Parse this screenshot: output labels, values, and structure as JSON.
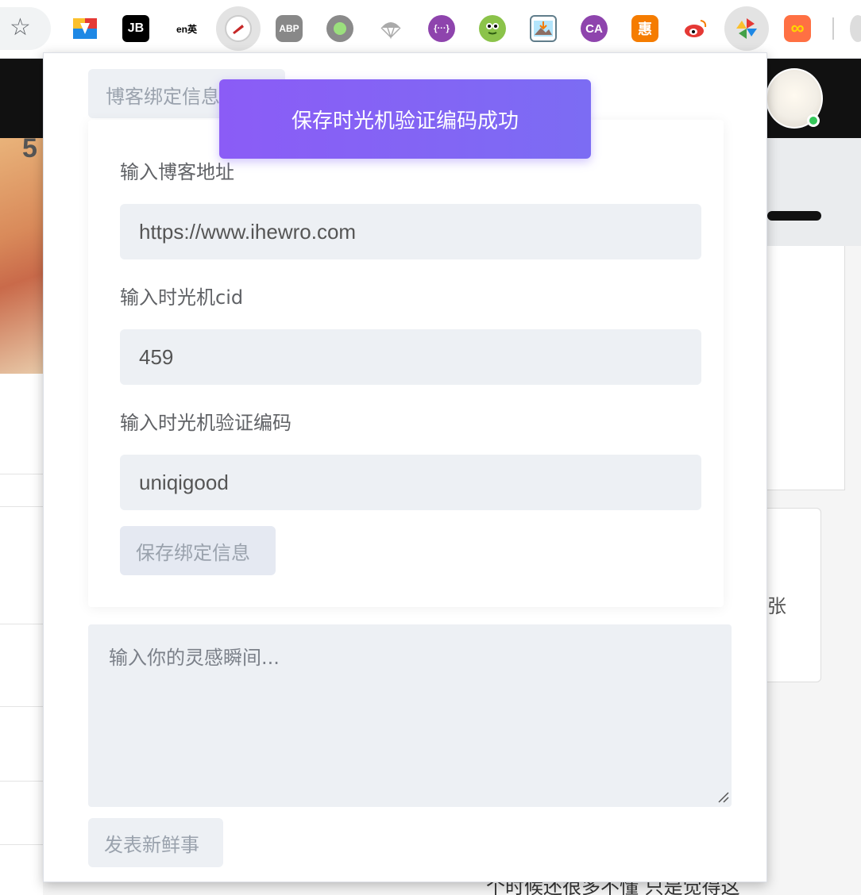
{
  "browser": {
    "bookmark_icon": "star-icon",
    "extensions": [
      {
        "name": "google-drive-icon",
        "label": "",
        "color": "#4caf50"
      },
      {
        "name": "jetbrains-icon",
        "label": "JB",
        "color": "#000000"
      },
      {
        "name": "translate-icon",
        "label": "en英",
        "color": "#ffffff"
      },
      {
        "name": "tab-extension-icon",
        "label": "",
        "color": "#e8e8e8"
      },
      {
        "name": "adblock-plus-icon",
        "label": "ABP",
        "color": "#7f7f7f"
      },
      {
        "name": "green-circle-icon",
        "label": "",
        "color": "#8a8a8a"
      },
      {
        "name": "parachute-icon",
        "label": "",
        "color": "#9a9a9a"
      },
      {
        "name": "dev-tools-icon",
        "label": "{···}",
        "color": "#8e44ad"
      },
      {
        "name": "alien-face-icon",
        "label": "",
        "color": "#7cb342"
      },
      {
        "name": "image-download-icon",
        "label": "",
        "color": "#607d8b"
      },
      {
        "name": "ca-icon",
        "label": "CA",
        "color": "#8e44ad"
      },
      {
        "name": "hui-icon",
        "label": "惠",
        "color": "#f57c00"
      },
      {
        "name": "weibo-icon",
        "label": "",
        "color": "#e53935"
      },
      {
        "name": "pinwheel-icon",
        "label": "",
        "color": "#fbc02d"
      },
      {
        "name": "infinity-icon",
        "label": "∞",
        "color": "#ff7043"
      }
    ]
  },
  "background": {
    "side_letter": "5",
    "side_text": "张",
    "bottom_text": "个时候还很多不懂 只是觉得这"
  },
  "popup": {
    "tab_label": "博客绑定信息",
    "toast": "保存时光机验证编码成功",
    "fields": [
      {
        "label": "输入博客地址",
        "value": "https://www.ihewro.com"
      },
      {
        "label": "输入时光机cid",
        "value": "459"
      },
      {
        "label": "输入时光机验证编码",
        "value": "uniqigood"
      }
    ],
    "save_button": "保存绑定信息",
    "textarea_placeholder": "输入你的灵感瞬间...",
    "post_button": "发表新鲜事"
  },
  "colors": {
    "toast_start": "#8b5cf6",
    "toast_end": "#7c6cf3",
    "input_bg": "#edf0f4",
    "online_dot": "#34c759"
  }
}
